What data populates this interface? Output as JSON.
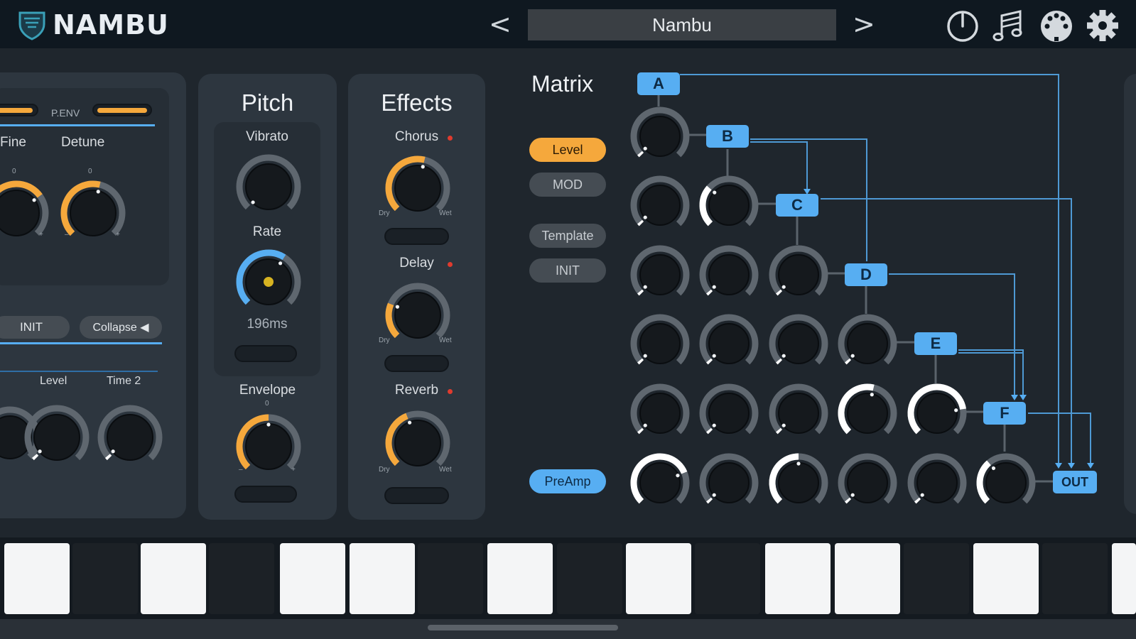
{
  "app": {
    "name": "NAMBU",
    "preset_name": "Nambu",
    "prev_label": "<",
    "next_label": ">"
  },
  "colors": {
    "accent_orange": "#f5a83c",
    "accent_blue": "#57aef2",
    "panel": "#2d363f",
    "topbar": "#0f1820"
  },
  "top_icons": [
    "power-icon",
    "music-notes-icon",
    "midi-port-icon",
    "gear-icon"
  ],
  "osc_panel": {
    "penv_label": "P.ENV",
    "fine_label": "Fine",
    "detune_label": "Detune",
    "fine_tick": "0",
    "detune_tick": "0",
    "minus": "–",
    "plus": "+",
    "init_label": "INIT",
    "collapse_label": "Collapse ◀",
    "level_label": "Level",
    "time2_label": "Time 2"
  },
  "pitch": {
    "title": "Pitch",
    "vibrato_label": "Vibrato",
    "rate_label": "Rate",
    "rate_value": "196ms",
    "envelope_label": "Envelope",
    "envelope_tick": "0",
    "minus": "–",
    "plus": "+"
  },
  "effects": {
    "title": "Effects",
    "chorus_label": "Chorus",
    "delay_label": "Delay",
    "reverb_label": "Reverb",
    "dry": "Dry",
    "wet": "Wet"
  },
  "matrix": {
    "title": "Matrix",
    "buttons": {
      "level": "Level",
      "mod": "MOD",
      "template": "Template",
      "init": "INIT",
      "preamp": "PreAmp"
    },
    "nodes": [
      "A",
      "B",
      "C",
      "D",
      "E",
      "F"
    ],
    "out_label": "OUT"
  }
}
